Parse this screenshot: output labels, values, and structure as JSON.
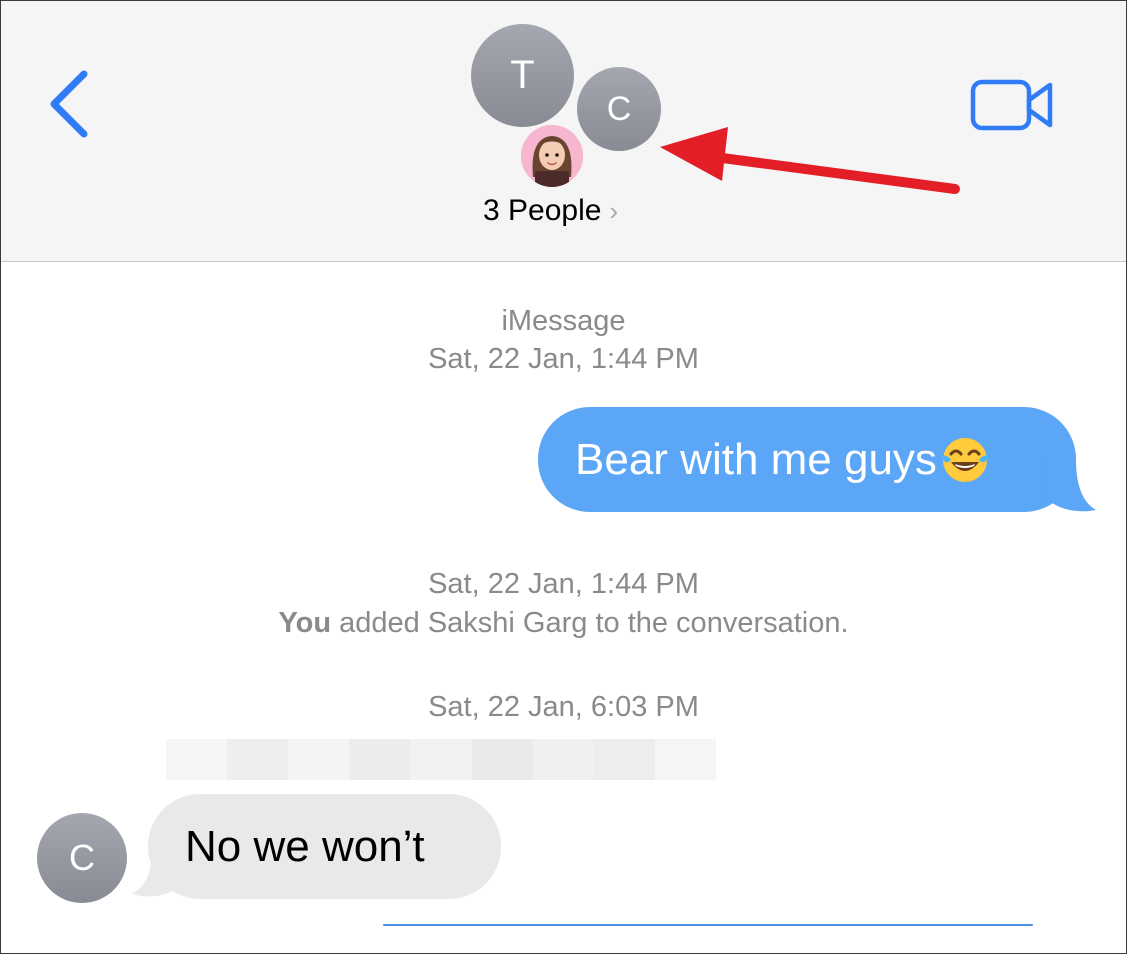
{
  "header": {
    "group_title": "3 People",
    "chevron": "›",
    "back_icon": "chevron-left-icon",
    "video_icon": "video-camera-icon",
    "avatars": [
      {
        "initial": "T"
      },
      {
        "initial": "C"
      },
      {
        "icon": "memoji-avatar"
      }
    ]
  },
  "conversation": {
    "service_label": "iMessage",
    "timestamp_1": "Sat, 22 Jan, 1:44 PM",
    "outgoing_message": "Bear with me guys",
    "outgoing_emoji": "😂",
    "timestamp_2": "Sat, 22 Jan, 1:44 PM",
    "system_note_actor": "You",
    "system_note_text": " added Sakshi Garg to the conversation.",
    "timestamp_3": "Sat, 22 Jan, 6:03 PM",
    "incoming_sender_initial": "C",
    "incoming_message": "No we won’t"
  },
  "colors": {
    "accent_blue": "#2f7cf6",
    "outgoing_bubble": "#5ba6f6",
    "incoming_bubble": "#e9e9eb",
    "annotation_arrow": "#e41e26"
  }
}
